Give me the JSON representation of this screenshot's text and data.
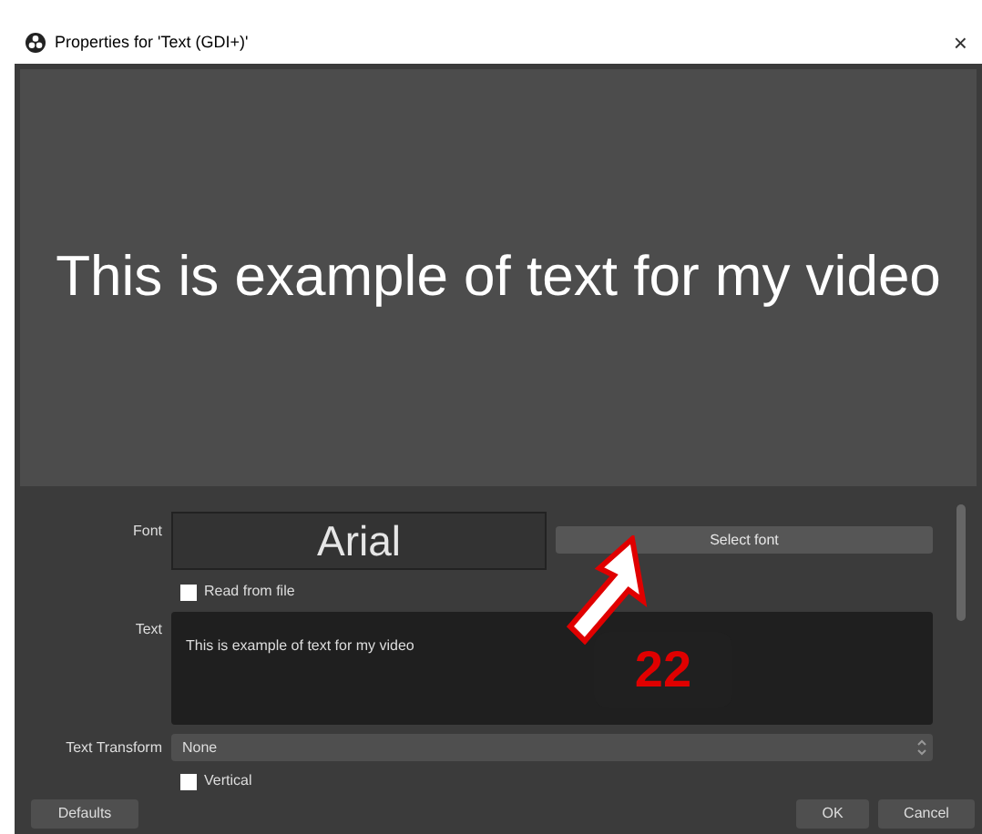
{
  "window": {
    "title": "Properties for 'Text (GDI+)'",
    "close": "×"
  },
  "preview": {
    "text": "This is example of text for my video"
  },
  "font": {
    "label": "Font",
    "value": "Arial",
    "button": "Select font"
  },
  "read_from_file": {
    "label": "Read from file",
    "checked": false
  },
  "text": {
    "label": "Text",
    "value": "This is example of text for my video"
  },
  "text_transform": {
    "label": "Text Transform",
    "value": "None"
  },
  "vertical": {
    "label": "Vertical",
    "checked": false
  },
  "buttons": {
    "defaults": "Defaults",
    "ok": "OK",
    "cancel": "Cancel"
  },
  "annotation": {
    "number": "22"
  }
}
